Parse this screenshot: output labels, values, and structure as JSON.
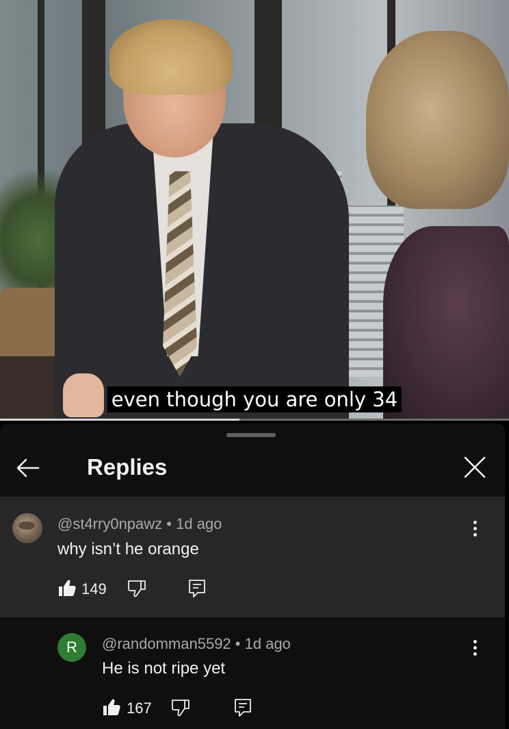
{
  "video": {
    "subtitle": "even though you are only 34",
    "progress_percent": 47
  },
  "panel": {
    "title": "Replies"
  },
  "comments": [
    {
      "handle": "@st4rry0npawz",
      "age": "1d ago",
      "text": "why isn’t he orange",
      "likes": "149"
    },
    {
      "avatar_letter": "R",
      "handle": "@randomman5592",
      "age": "1d ago",
      "text": "He is not ripe yet",
      "likes": "167"
    }
  ],
  "separator": "•",
  "colors": {
    "panel_bg": "#0f0f0f",
    "highlight_bg": "#272727",
    "text_primary": "#f1f1f1",
    "text_secondary": "#aaaaaa",
    "avatar_green": "#2e7d32"
  }
}
